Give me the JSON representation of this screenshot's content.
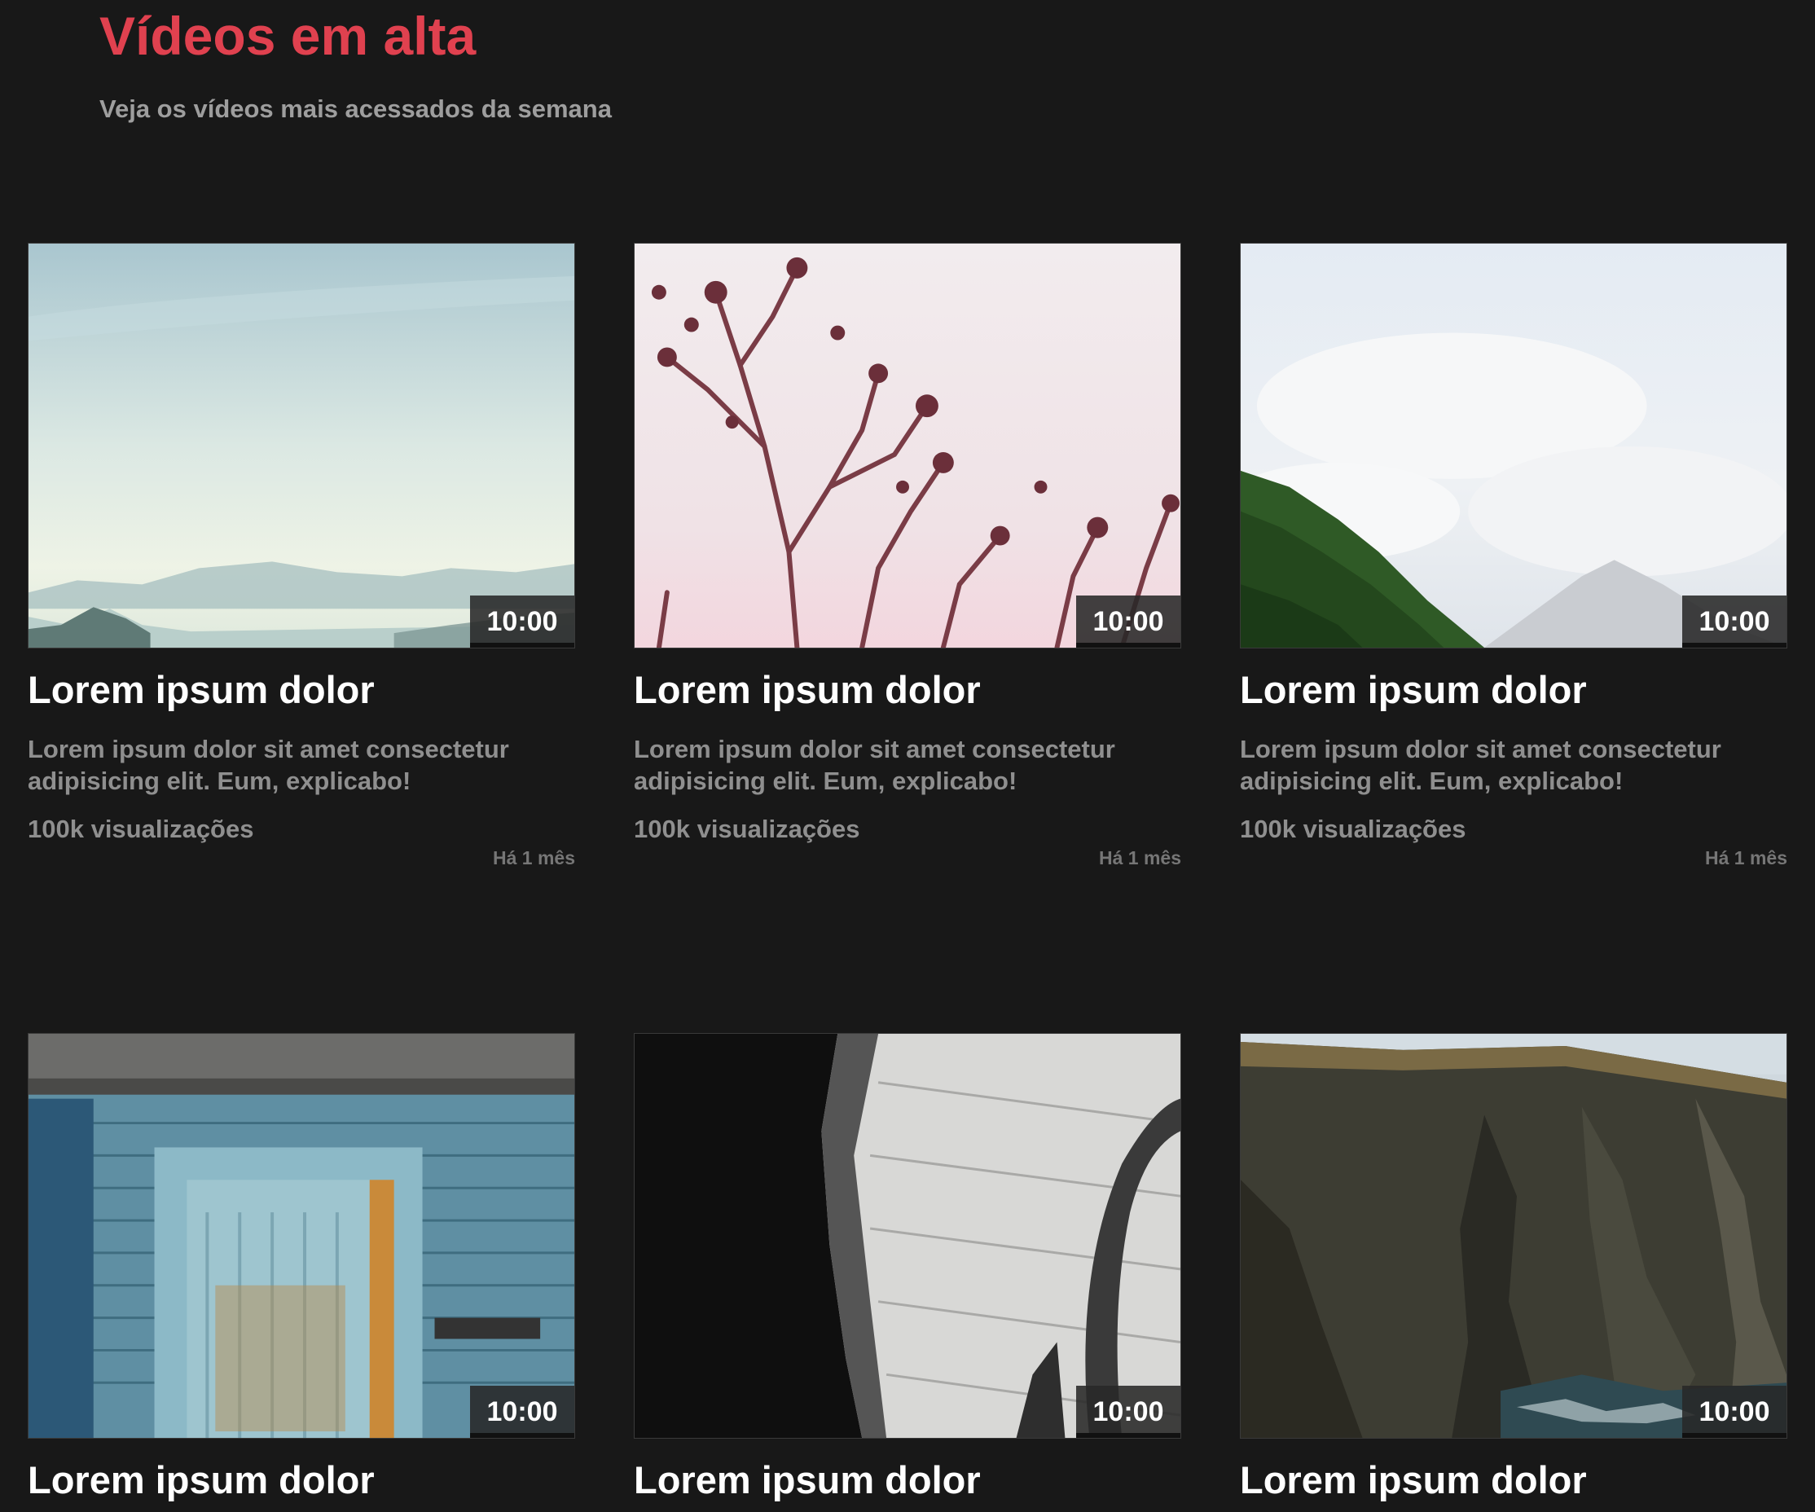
{
  "header": {
    "title": "Vídeos em alta",
    "subtitle": "Veja os vídeos mais acessados da semana"
  },
  "colors": {
    "background": "#181818",
    "title_accent": "#e0414f",
    "muted_text": "#8f8f8f"
  },
  "videos": [
    {
      "thumbnail_icon": "misty-lake-mountains-image",
      "duration": "10:00",
      "title": "Lorem ipsum dolor",
      "description": "Lorem ipsum dolor sit amet consectetur adipisicing elit. Eum, explicabo!",
      "views": "100k visualizações",
      "age": "Há 1 mês"
    },
    {
      "thumbnail_icon": "plant-silhouette-image",
      "duration": "10:00",
      "title": "Lorem ipsum dolor",
      "description": "Lorem ipsum dolor sit amet consectetur adipisicing elit. Eum, explicabo!",
      "views": "100k visualizações",
      "age": "Há 1 mês"
    },
    {
      "thumbnail_icon": "cloudy-mountain-forest-image",
      "duration": "10:00",
      "title": "Lorem ipsum dolor",
      "description": "Lorem ipsum dolor sit amet consectetur adipisicing elit. Eum, explicabo!",
      "views": "100k visualizações",
      "age": "Há 1 mês"
    },
    {
      "thumbnail_icon": "old-blue-door-image",
      "duration": "10:00",
      "title": "Lorem ipsum dolor"
    },
    {
      "thumbnail_icon": "weathered-wood-shadow-image",
      "duration": "10:00",
      "title": "Lorem ipsum dolor"
    },
    {
      "thumbnail_icon": "sea-cliffs-image",
      "duration": "10:00",
      "title": "Lorem ipsum dolor"
    }
  ]
}
